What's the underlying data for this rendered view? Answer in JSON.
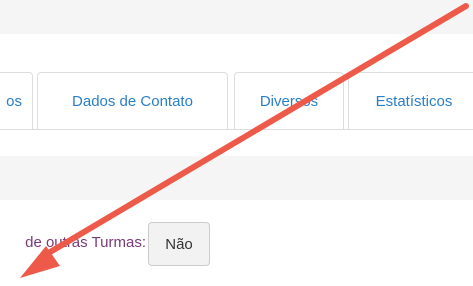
{
  "tabs": [
    {
      "label": "os",
      "partial": true
    },
    {
      "label": "Dados de Contato"
    },
    {
      "label": "Diversos"
    },
    {
      "label": "Estatísticos"
    }
  ],
  "field": {
    "label": "de outras Turmas:",
    "button_label": "Não"
  },
  "annotation": {
    "type": "arrow",
    "color": "#ee5a49"
  }
}
